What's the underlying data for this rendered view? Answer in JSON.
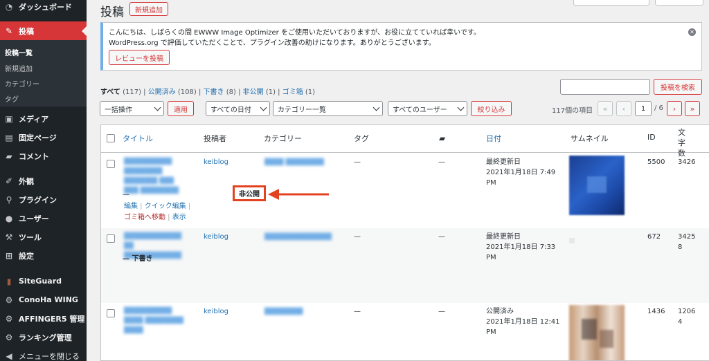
{
  "sidebar": {
    "items": [
      {
        "label": "ダッシュボード",
        "icon": "dashboard-icon"
      },
      {
        "label": "投稿",
        "icon": "pin-icon",
        "active": true
      },
      {
        "label": "メディア",
        "icon": "media-icon"
      },
      {
        "label": "固定ページ",
        "icon": "page-icon"
      },
      {
        "label": "コメント",
        "icon": "comment-icon"
      },
      {
        "label": "外観",
        "icon": "brush-icon"
      },
      {
        "label": "プラグイン",
        "icon": "plugin-icon"
      },
      {
        "label": "ユーザー",
        "icon": "user-icon"
      },
      {
        "label": "ツール",
        "icon": "wrench-icon"
      },
      {
        "label": "設定",
        "icon": "settings-icon"
      },
      {
        "label": "SiteGuard",
        "icon": "siteguard-icon"
      },
      {
        "label": "ConoHa WING",
        "icon": "gear-icon"
      },
      {
        "label": "AFFINGER5 管理",
        "icon": "gear-icon"
      },
      {
        "label": "ランキング管理",
        "icon": "gear-icon"
      },
      {
        "label": "メニューを閉じる",
        "icon": "collapse-icon"
      }
    ],
    "submenu": [
      "投稿一覧",
      "新規追加",
      "カテゴリー",
      "タグ"
    ]
  },
  "header": {
    "title": "投稿",
    "add_new": "新規追加"
  },
  "notice": {
    "line1": "こんにちは、しばらくの間 EWWW Image Optimizer をご使用いただいておりますが、お役に立てていれば幸いです。",
    "line2": "WordPress.org で評価していただくことで、プラグイン改善の助けになります。ありがとうございます。",
    "review_button": "レビューを投稿"
  },
  "filters": {
    "all": "すべて",
    "all_count": "(117)",
    "published": "公開済み",
    "published_count": "(108)",
    "draft": "下書き",
    "draft_count": "(8)",
    "private": "非公開",
    "private_count": "(1)",
    "trash": "ゴミ箱",
    "trash_count": "(1)",
    "search_button": "投稿を検索",
    "bulk_action": "一括操作",
    "apply": "適用",
    "all_dates": "すべての日付",
    "category_list": "カテゴリー一覧",
    "all_users": "すべてのユーザー",
    "filter_button": "絞り込み",
    "items_count": "117個の項目",
    "page_current": "1",
    "page_total": "/ 6"
  },
  "table": {
    "columns": [
      "タイトル",
      "投稿者",
      "カテゴリー",
      "タグ",
      "日付",
      "サムネイル",
      "ID",
      "文字数"
    ],
    "rows": [
      {
        "status": "非公開",
        "author": "keiblog",
        "tags": "—",
        "comments": "—",
        "date_status": "最終更新日",
        "date": "2021年1月18日 7:49",
        "date_ampm": "PM",
        "id": "5500",
        "chars": "3426",
        "actions": {
          "edit": "編集",
          "quick_edit": "クイック編集",
          "trash": "ゴミ箱へ移動",
          "view": "表示"
        }
      },
      {
        "status": "— 下書き",
        "author": "keiblog",
        "tags": "—",
        "comments": "—",
        "date_status": "最終更新日",
        "date": "2021年1月18日 7:33",
        "date_ampm": "PM",
        "id": "672",
        "chars_1": "3425",
        "chars_2": "8"
      },
      {
        "author": "keiblog",
        "tags": "—",
        "comments": "—",
        "date_status": "公開済み",
        "date": "2021年1月18日 12:41",
        "date_ampm": "PM",
        "id": "1436",
        "chars_1": "1206",
        "chars_2": "4"
      }
    ]
  },
  "annotation": {
    "label": "非公開",
    "color": "#e2421f"
  },
  "colors": {
    "accent": "#d63638",
    "link": "#2271b1",
    "sidebar": "#1d2327"
  }
}
